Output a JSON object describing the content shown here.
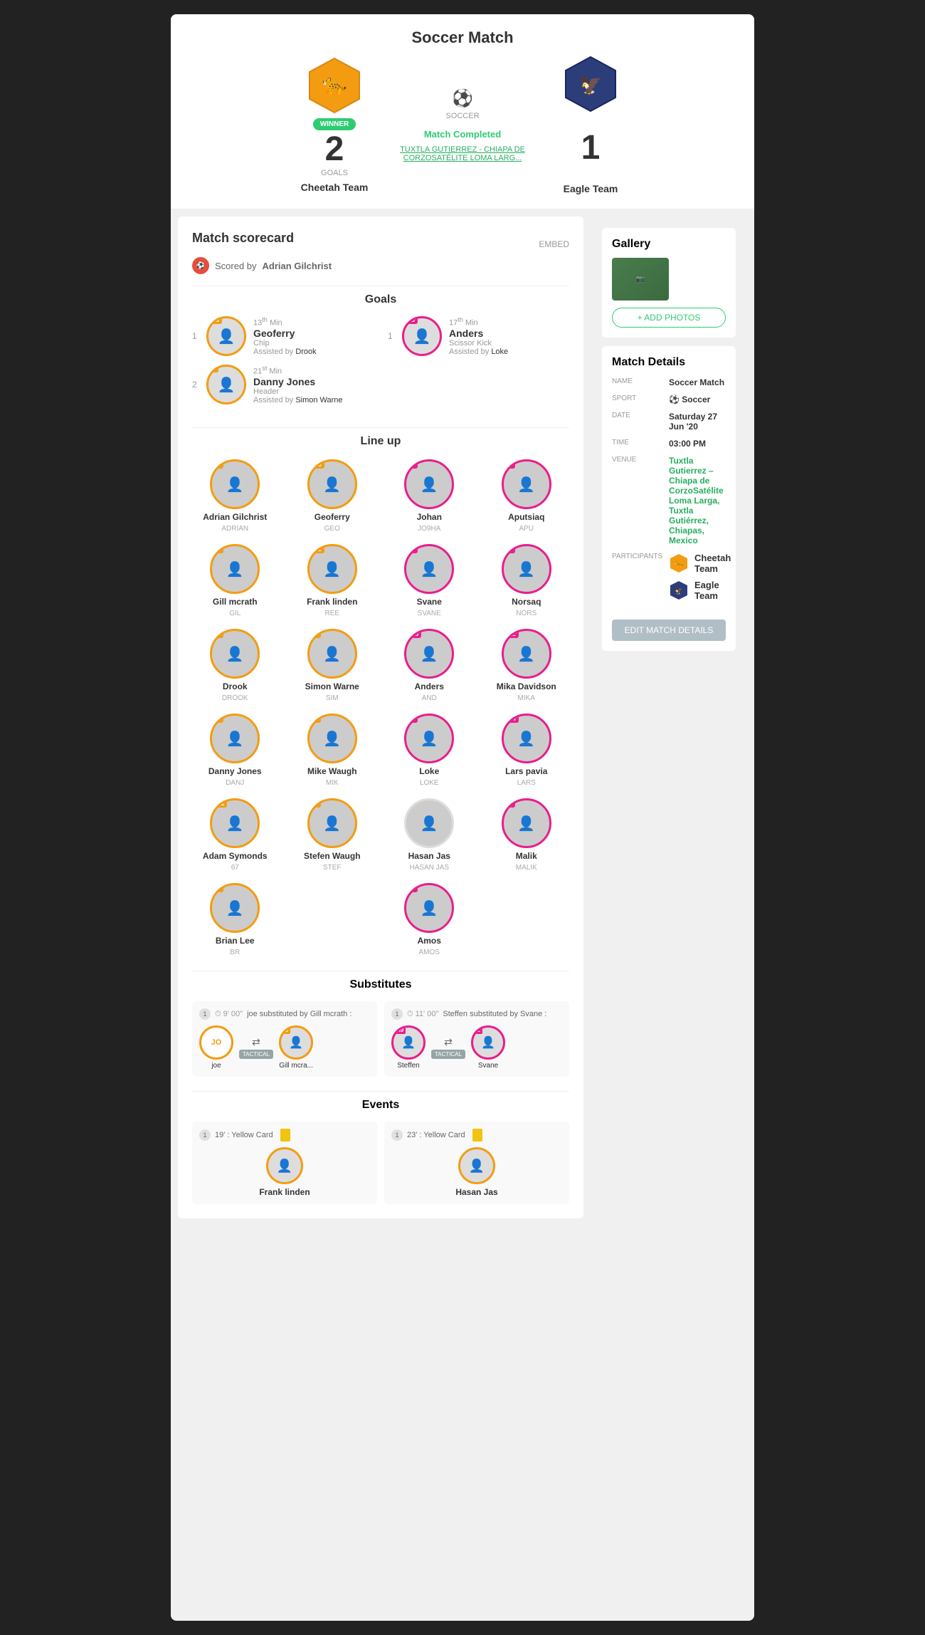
{
  "header": {
    "title": "Soccer Match",
    "sport": "Soccer",
    "status": "Match Completed",
    "venue": "TUXTLA GUTIERREZ - CHIAPA DE CORZOSATÉLITE LOMA LARG...",
    "team_left": {
      "name": "Cheetah Team",
      "score": "2",
      "goals_label": "GOALS",
      "winner": true,
      "winner_label": "WINNER"
    },
    "team_right": {
      "name": "Eagle Team",
      "score": "1"
    }
  },
  "scorecard": {
    "title": "Match scorecard",
    "scored_by_label": "Scored by",
    "scorer_name": "Adrian Gilchrist",
    "embed_label": "EMBED"
  },
  "goals": {
    "title": "Goals",
    "left": [
      {
        "number": "1",
        "badge": "236",
        "time": "13",
        "time_sup": "th",
        "time_unit": "Min",
        "name": "Geoferry",
        "type": "Chip",
        "assist": "Assisted by",
        "assister": "Drook",
        "team": "cheetah"
      },
      {
        "number": "2",
        "badge": "35",
        "time": "21",
        "time_sup": "st",
        "time_unit": "Min",
        "name": "Danny Jones",
        "type": "Header",
        "assist": "Assisted by",
        "assister": "Simon Warne",
        "team": "cheetah"
      }
    ],
    "right": [
      {
        "number": "1",
        "badge": "245",
        "time": "17",
        "time_sup": "th",
        "time_unit": "Min",
        "name": "Anders",
        "type": "Scissor Kick",
        "assist": "Assisted by",
        "assister": "Loke",
        "team": "eagle"
      }
    ]
  },
  "lineup": {
    "title": "Line up",
    "players": [
      {
        "name": "Adrian Gilchrist",
        "tag": "ADRIAN",
        "number": "48",
        "team": "cheetah",
        "color": "orange"
      },
      {
        "name": "Geoferry",
        "tag": "GEO",
        "number": "236",
        "team": "cheetah",
        "color": "orange"
      },
      {
        "name": "Johan",
        "tag": "JO9HA",
        "number": "34",
        "team": "eagle",
        "color": "pink"
      },
      {
        "name": "Aputsiaq",
        "tag": "APU",
        "number": "67",
        "team": "eagle",
        "color": "pink"
      },
      {
        "name": "Gill mcrath",
        "tag": "GIL",
        "number": "23",
        "team": "cheetah",
        "color": "orange"
      },
      {
        "name": "Frank linden",
        "tag": "REE",
        "number": "222",
        "team": "cheetah",
        "color": "orange"
      },
      {
        "name": "Svane",
        "tag": "SVANE",
        "number": "42",
        "team": "eagle",
        "color": "pink"
      },
      {
        "name": "Norsaq",
        "tag": "NORS",
        "number": "24",
        "team": "eagle",
        "color": "pink"
      },
      {
        "name": "Drook",
        "tag": "DROOK",
        "number": "38",
        "team": "cheetah",
        "color": "orange"
      },
      {
        "name": "Simon Warne",
        "tag": "SIM",
        "number": "34",
        "team": "cheetah",
        "color": "orange"
      },
      {
        "name": "Anders",
        "tag": "AND",
        "number": "245",
        "team": "eagle",
        "color": "pink"
      },
      {
        "name": "Mika Davidson",
        "tag": "MIKA",
        "number": "232",
        "team": "eagle",
        "color": "pink"
      },
      {
        "name": "Danny Jones",
        "tag": "DANJ",
        "number": "35",
        "team": "cheetah",
        "color": "orange"
      },
      {
        "name": "Mike Waugh",
        "tag": "MIK",
        "number": "13",
        "team": "cheetah",
        "color": "orange"
      },
      {
        "name": "Loke",
        "tag": "LOKE",
        "number": "23",
        "team": "eagle",
        "color": "pink"
      },
      {
        "name": "Lars pavia",
        "tag": "LARS",
        "number": "234",
        "team": "eagle",
        "color": "pink"
      },
      {
        "name": "Adam Symonds",
        "tag": "67",
        "number": "221",
        "team": "cheetah",
        "color": "orange"
      },
      {
        "name": "Stefen Waugh",
        "tag": "STEF",
        "number": "63",
        "team": "cheetah",
        "color": "orange"
      },
      {
        "name": "Hasan Jas",
        "tag": "HASAN JAS",
        "number": "",
        "team": "eagle",
        "color": "pink"
      },
      {
        "name": "Malik",
        "tag": "MALIK",
        "number": "32",
        "team": "eagle",
        "color": "pink"
      },
      {
        "name": "Brian Lee",
        "tag": "BR",
        "number": "56",
        "team": "cheetah",
        "color": "orange"
      },
      {
        "name": "",
        "tag": "",
        "number": "",
        "team": "",
        "color": ""
      },
      {
        "name": "Amos",
        "tag": "AMOS",
        "number": "43",
        "team": "eagle",
        "color": "pink"
      },
      {
        "name": "",
        "tag": "",
        "number": "",
        "team": "",
        "color": ""
      }
    ]
  },
  "substitutes": {
    "title": "Substitutes",
    "items": [
      {
        "number": "1",
        "time": "9' 00\"",
        "description": "joe substituted by Gill mcrath :",
        "player_out": "joe",
        "player_out_number": "",
        "player_in": "Gill mcra...",
        "player_in_number": "23",
        "tactical": true
      },
      {
        "number": "1",
        "time": "11' 00\"",
        "description": "Steffen substituted by Svane :",
        "player_out": "Steffen",
        "player_out_number": "349",
        "player_in": "Svane",
        "player_in_number": "42",
        "tactical": true
      }
    ],
    "tactical_label": "TACTICAL"
  },
  "events": {
    "title": "Events",
    "items": [
      {
        "number": "1",
        "time": "19'",
        "type": "Yellow Card",
        "player": "Frank linden",
        "team": "cheetah"
      },
      {
        "number": "1",
        "time": "23'",
        "type": "Yellow Card",
        "player": "Hasan Jas",
        "team": "eagle"
      }
    ]
  },
  "gallery": {
    "title": "Gallery",
    "add_photos_label": "+ ADD PHOTOS"
  },
  "match_details": {
    "title": "Match Details",
    "rows": [
      {
        "label": "NAME",
        "value": "Soccer Match"
      },
      {
        "label": "SPORT",
        "value": "⚽ Soccer"
      },
      {
        "label": "DATE",
        "value": "Saturday 27 Jun '20"
      },
      {
        "label": "TIME",
        "value": "03:00 PM"
      },
      {
        "label": "VENUE",
        "value": "Tuxtla Gutierrez – Chiapa de CorzoSatélite Loma Larga, Tuxtla Gutiérrez, Chiapas, Mexico"
      }
    ],
    "participants_label": "PARTICIPANTS",
    "participants": [
      {
        "name": "Cheetah Team"
      },
      {
        "name": "Eagle Team"
      }
    ],
    "edit_label": "EDIT MATCH DETAILS"
  }
}
